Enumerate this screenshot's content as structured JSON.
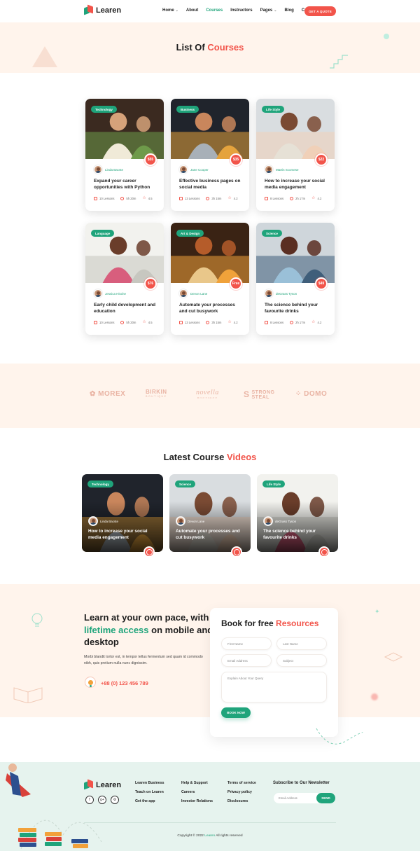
{
  "header": {
    "brand": "Learen",
    "nav": [
      {
        "label": "Home",
        "has_dropdown": true
      },
      {
        "label": "About",
        "has_dropdown": false
      },
      {
        "label": "Courses",
        "has_dropdown": false,
        "active": true
      },
      {
        "label": "Instructors",
        "has_dropdown": false
      },
      {
        "label": "Pages",
        "has_dropdown": true
      },
      {
        "label": "Blog",
        "has_dropdown": false
      },
      {
        "label": "Contact",
        "has_dropdown": false
      }
    ],
    "cta": "GET A QUOTE"
  },
  "hero": {
    "title_main": "List Of",
    "title_accent": "Courses"
  },
  "courses": [
    {
      "category": "Technology",
      "price": "$55",
      "author": "Linda Bacste",
      "title": "Expand your career opportunities with Python",
      "lessons": "10 Lessons",
      "duration": "5h 20m",
      "rating": "4.5"
    },
    {
      "category": "Business",
      "price": "$35",
      "author": "Jane Cooper",
      "title": "Effective business pages on social media",
      "lessons": "13 Lessons",
      "duration": "3h 15m",
      "rating": "4.2"
    },
    {
      "category": "Life Style",
      "price": "$22",
      "author": "Martin Scorsese",
      "title": "How to increase your social media engagement",
      "lessons": "8 Lessons",
      "duration": "2h 17m",
      "rating": "4.2"
    },
    {
      "category": "Language",
      "price": "$76",
      "author": "Jessica Hische",
      "title": "Early child development and education",
      "lessons": "10 Lessons",
      "duration": "5h 20m",
      "rating": "4.5"
    },
    {
      "category": "Art & Design",
      "price": "Free",
      "author": "Devon Lane",
      "title": "Automate your processes and cut busywork",
      "lessons": "13 Lessons",
      "duration": "3h 15m",
      "rating": "4.2"
    },
    {
      "category": "Science",
      "price": "$49",
      "author": "deGrass Tyson",
      "title": "The science behind your favourite drinks",
      "lessons": "8 Lessons",
      "duration": "2h 17m",
      "rating": "4.2"
    }
  ],
  "brands": [
    {
      "name": "MOREX",
      "sub": ""
    },
    {
      "name": "BIRKIN",
      "sub": "BOUTIQUE"
    },
    {
      "name": "novella",
      "sub": "BOUTIQUE"
    },
    {
      "name": "STRONG STEAL",
      "sub": ""
    },
    {
      "name": "DOMO",
      "sub": ""
    }
  ],
  "videos": {
    "title_main": "Latest Course",
    "title_accent": "Videos",
    "items": [
      {
        "category": "Technology",
        "author": "Linda Bacste",
        "title": "How to increase your social media engagement"
      },
      {
        "category": "Science",
        "author": "Devon Lane",
        "title": "Automate your processes and cut busywork"
      },
      {
        "category": "Life Style",
        "author": "deGrass Tyson",
        "title": "The science behind your favourite drinks"
      }
    ]
  },
  "learn": {
    "head_1": "Learn at your own pace, with",
    "head_accent": "lifetime access",
    "head_2": "on mobile and desktop",
    "text": "Morbi blandit tortor est, in tempor tellus fermentum sed quam id commodo nibh, quis pretium nulla nunc dignissim.",
    "phone": "+88 (0) 123 456 789"
  },
  "form": {
    "title_main": "Book for free",
    "title_accent": "Resources",
    "first_name": "First Name",
    "last_name": "Last Name",
    "email": "Email Address",
    "subject": "Subject",
    "query": "Explain About Your Query",
    "button": "BOOK NOW"
  },
  "footer": {
    "brand": "Learen",
    "social": [
      "f",
      "g+",
      "⚙"
    ],
    "col1": [
      "Learen Business",
      "Teach on Learen",
      "Get the app"
    ],
    "col2": [
      "Help & Support",
      "Careers",
      "Investor Relations"
    ],
    "col3": [
      "Terms of service",
      "Privacy policy",
      "Disclosures"
    ],
    "newsletter_title": "Subscribe to Our Newsletter",
    "newsletter_placeholder": "Email Address",
    "newsletter_button": "SEND",
    "copyright_pre": "Copyright © 2022",
    "copyright_brand": "Learen",
    "copyright_post": "All rights reserved"
  },
  "colors": {
    "accent": "#f2544a",
    "brand": "#1fa47b",
    "tint": "#fff4ec",
    "footer": "#e6f3ee"
  }
}
